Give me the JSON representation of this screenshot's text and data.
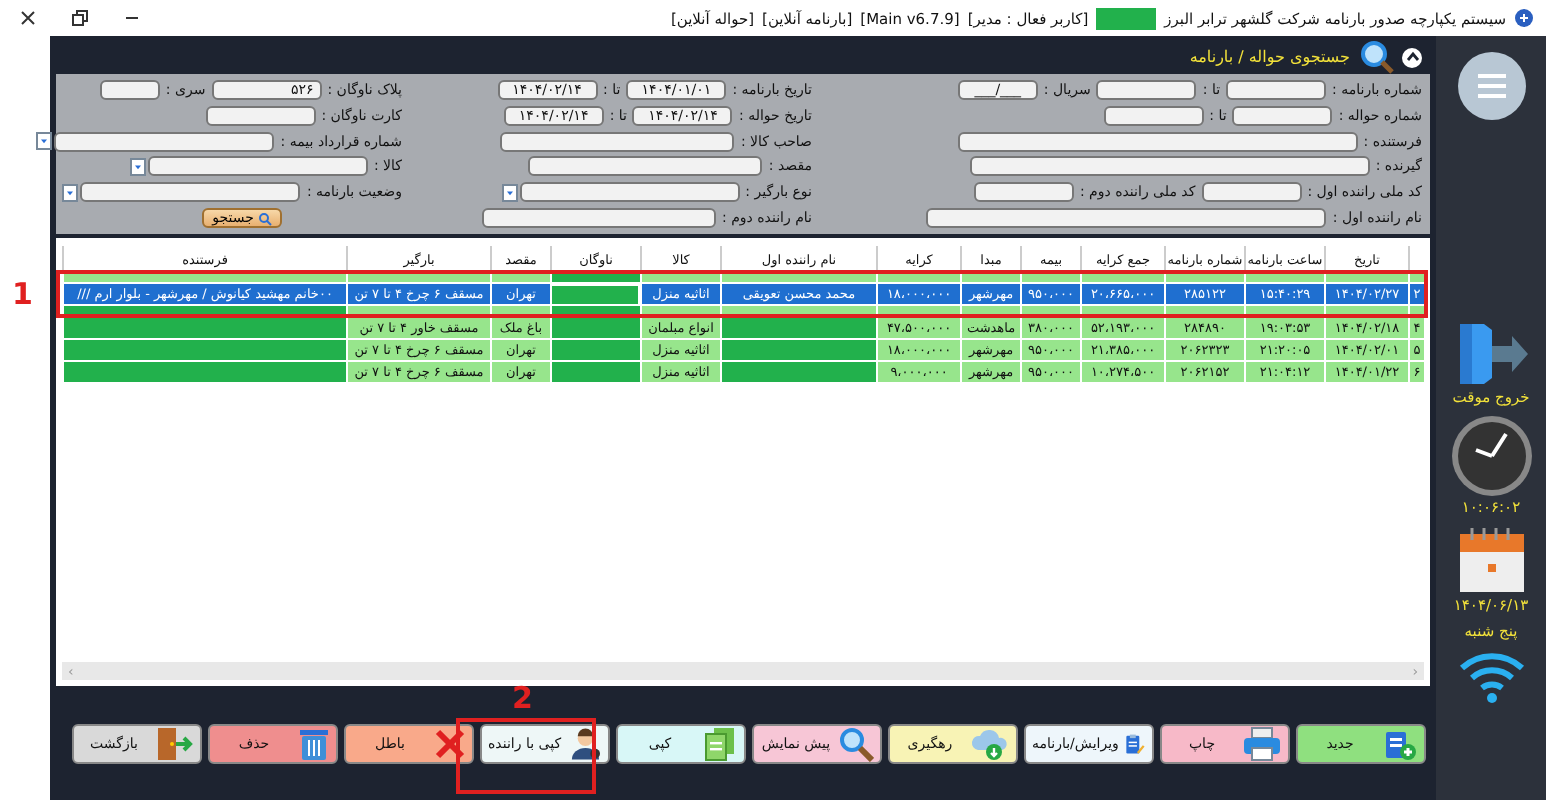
{
  "window": {
    "title_parts": [
      {
        "text": "سیستم یکپارچه صدور بارنامه شرکت گلشهر ترابر البرز",
        "redacted": false
      },
      {
        "redacted": true
      },
      {
        "text": "[کاربر فعال : مدیر]",
        "redacted": false
      },
      {
        "text": "[Main v6.7.9]",
        "redacted": false
      },
      {
        "text": "[بارنامه آنلاین]",
        "redacted": false
      },
      {
        "text": "[حواله آنلاین]",
        "redacted": false
      }
    ]
  },
  "search_panel": {
    "title": "جستجوی حواله / بارنامه",
    "expanded": true,
    "rows": [
      {
        "groups": [
          [
            {
              "label": "شماره بارنامه :",
              "kind": "short"
            },
            {
              "label": "تا :",
              "kind": "short"
            },
            {
              "label": "سریال :",
              "kind": "serial",
              "value": "___/___"
            }
          ],
          [
            {
              "label": "تاریخ بارنامه :",
              "kind": "date",
              "value": "۱۴۰۴/۰۱/۰۱"
            },
            {
              "label": "تا :",
              "kind": "date",
              "value": "۱۴۰۴/۰۲/۱۴"
            }
          ],
          [
            {
              "label": "پلاک ناوگان :",
              "kind": "mid",
              "value": "۵۲۶"
            },
            {
              "label": "سری :",
              "kind": "tiny"
            }
          ]
        ]
      },
      {
        "groups": [
          [
            {
              "label": "شماره حواله :",
              "kind": "short"
            },
            {
              "label": "تا :",
              "kind": "short"
            }
          ],
          [
            {
              "label": "تاریخ حواله :",
              "kind": "date",
              "value": "۱۴۰۴/۰۲/۱۴"
            },
            {
              "label": "تا :",
              "kind": "date",
              "value": "۱۴۰۴/۰۲/۱۴"
            }
          ],
          [
            {
              "label": "کارت ناوگان :",
              "kind": "mid"
            }
          ]
        ]
      },
      {
        "groups": [
          [
            {
              "label": "فرستنده :",
              "kind": "wide"
            }
          ],
          [
            {
              "label": "صاحب کالا :",
              "kind": "medium"
            }
          ],
          [
            {
              "label": "شماره قرارداد بیمه :",
              "kind": "dropdown"
            }
          ]
        ]
      },
      {
        "groups": [
          [
            {
              "label": "گیرنده :",
              "kind": "wide"
            }
          ],
          [
            {
              "label": "مقصد :",
              "kind": "medium"
            }
          ],
          [
            {
              "label": "کالا :",
              "kind": "dropdown"
            }
          ]
        ]
      },
      {
        "groups": [
          [
            {
              "label": "کد ملی راننده اول :",
              "kind": "short"
            },
            {
              "label": "کد ملی راننده دوم :",
              "kind": "short"
            }
          ],
          [
            {
              "label": "نوع بارگیر :",
              "kind": "dropdown-medium"
            }
          ],
          [
            {
              "label": "وضعیت بارنامه :",
              "kind": "dropdown"
            }
          ]
        ]
      },
      {
        "groups": [
          [
            {
              "label": "نام راننده اول :",
              "kind": "wide"
            }
          ],
          [
            {
              "label": "نام راننده دوم :",
              "kind": "medium"
            }
          ]
        ]
      }
    ],
    "search_button": "جستجو"
  },
  "table": {
    "columns": [
      null,
      "تاریخ",
      "ساعت بارنامه",
      "شماره بارنامه",
      "جمع کرایه",
      "بیمه",
      "مبدا",
      "کرایه",
      "نام راننده اول",
      "کالا",
      "ناوگان",
      "مقصد",
      "بارگیر",
      "فرستنده"
    ],
    "rows": [
      {
        "selected": false,
        "partial": true,
        "cells": [
          null,
          null,
          null,
          null,
          null,
          null,
          null,
          null,
          null,
          null,
          {
            "redacted": true
          },
          null,
          null,
          null
        ]
      },
      {
        "selected": true,
        "cells": [
          "۲",
          "۱۴۰۴/۰۲/۲۷",
          "۱۵:۴۰:۲۹",
          "۲۸۵۱۲۲",
          "۲۰،۶۶۵،۰۰۰",
          "۹۵۰،۰۰۰",
          "مهرشهر",
          "۱۸،۰۰۰،۰۰۰",
          "محمد محسن تعویقی",
          "اثاثیه منزل",
          {
            "redacted": true
          },
          "تهران",
          "مسقف ۶ چرخ ۴ تا ۷ تن",
          "۰۰خانم مهشید کیانوش / مهرشهر - بلوار ارم ///"
        ]
      },
      {
        "selected": false,
        "partial": true,
        "cells": [
          null,
          null,
          null,
          null,
          null,
          null,
          null,
          null,
          null,
          null,
          {
            "redacted": true
          },
          null,
          null,
          {
            "redacted": true
          }
        ]
      },
      {
        "selected": false,
        "cells": [
          "۴",
          "۱۴۰۴/۰۲/۱۸",
          "۱۹:۰۳:۵۳",
          "۲۸۴۸۹۰",
          "۵۲،۱۹۳،۰۰۰",
          "۳۸۰،۰۰۰",
          "ماهدشت",
          "۴۷،۵۰۰،۰۰۰",
          {
            "redacted": true
          },
          "انواع مبلمان",
          {
            "redacted": true
          },
          "باغ ملک",
          "مسقف خاور ۴ تا ۷ تن",
          {
            "redacted": true
          }
        ]
      },
      {
        "selected": false,
        "cells": [
          "۵",
          "۱۴۰۴/۰۲/۰۱",
          "۲۱:۲۰:۰۵",
          "۲۰۶۲۳۲۳",
          "۲۱،۳۸۵،۰۰۰",
          "۹۵۰،۰۰۰",
          "مهرشهر",
          "۱۸،۰۰۰،۰۰۰",
          {
            "redacted": true
          },
          "اثاثیه منزل",
          {
            "redacted": true
          },
          "تهران",
          "مسقف ۶ چرخ ۴ تا ۷ تن",
          {
            "redacted": true
          }
        ]
      },
      {
        "selected": false,
        "cells": [
          "۶",
          "۱۴۰۴/۰۱/۲۲",
          "۲۱:۰۴:۱۲",
          "۲۰۶۲۱۵۲",
          "۱۰،۲۷۴،۵۰۰",
          "۹۵۰،۰۰۰",
          "مهرشهر",
          "۹،۰۰۰،۰۰۰",
          {
            "redacted": true
          },
          "اثاثیه منزل",
          {
            "redacted": true
          },
          "تهران",
          "مسقف ۶ چرخ ۴ تا ۷ تن",
          {
            "redacted": true
          }
        ]
      }
    ]
  },
  "scrollbar": {
    "left_arrow": "‹",
    "right_arrow": "›"
  },
  "toolbar": [
    {
      "label": "جدید",
      "color": "#8fe07f"
    },
    {
      "label": "چاپ",
      "color": "#f7b9c8"
    },
    {
      "label": "ویرایش/بارنامه",
      "color": "#eef6fb"
    },
    {
      "label": "رهگیری",
      "color": "#f8f3b5"
    },
    {
      "label": "پیش نمایش",
      "color": "#f7c6d6"
    },
    {
      "label": "کپی",
      "color": "#d8f7f7"
    },
    {
      "label": "کپی با راننده",
      "color": "#eef7f7"
    },
    {
      "label": "باطل",
      "color": "#f9a98a"
    },
    {
      "label": "حذف",
      "color": "#ef8e8e"
    },
    {
      "label": "بازگشت",
      "color": "#d9d9d9"
    }
  ],
  "sidebar": {
    "exit_label": "خروج موقت",
    "time": "۱۰:۰۶:۰۲",
    "date": "۱۴۰۴/۰۶/۱۳",
    "weekday": "پنج شنبه"
  },
  "annotations": [
    {
      "label": "1"
    },
    {
      "label": "2"
    }
  ]
}
